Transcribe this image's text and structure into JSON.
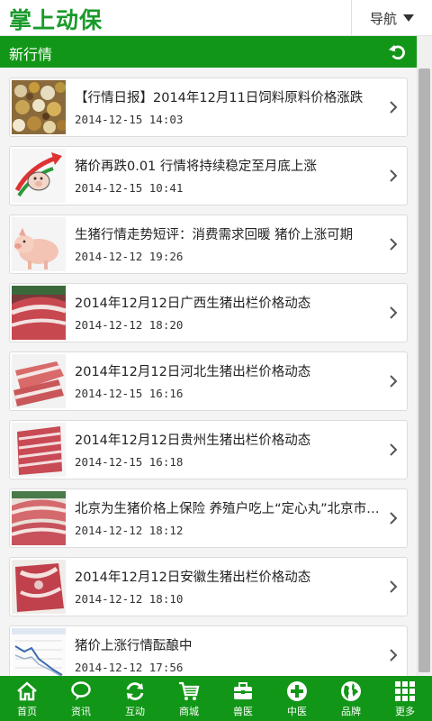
{
  "header": {
    "logo": "掌上动保",
    "nav_label": "导航"
  },
  "section": {
    "title": "新行情"
  },
  "news": [
    {
      "title": "【行情日报】2014年12月11日饲料原料价格涨跌",
      "date": "2014-12-15 14:03",
      "thumb": "grains-icon"
    },
    {
      "title": "猪价再跌0.01 行情将持续稳定至月底上涨",
      "date": "2014-12-15 10:41",
      "thumb": "pig-arrow-icon"
    },
    {
      "title": "生猪行情走势短评：消费需求回暖 猪价上涨可期",
      "date": "2014-12-12 19:26",
      "thumb": "piglet-icon"
    },
    {
      "title": "2014年12月12日广西生猪出栏价格动态",
      "date": "2014-12-12 18:20",
      "thumb": "pork-icon"
    },
    {
      "title": "2014年12月12日河北生猪出栏价格动态",
      "date": "2014-12-15 16:16",
      "thumb": "pork-icon"
    },
    {
      "title": "2014年12月12日贵州生猪出栏价格动态",
      "date": "2014-12-15 16:18",
      "thumb": "pork-icon"
    },
    {
      "title": "北京为生猪价格上保险 养殖户吃上“定心丸”北京市生猪价格指数保险试点",
      "date": "2014-12-12 18:12",
      "thumb": "pork-icon"
    },
    {
      "title": "2014年12月12日安徽生猪出栏价格动态",
      "date": "2014-12-12 18:10",
      "thumb": "pork-icon"
    },
    {
      "title": "猪价上涨行情酝酿中",
      "date": "2014-12-12 17:56",
      "thumb": "price-chart-icon"
    }
  ],
  "tabs": [
    {
      "label": "首页",
      "icon": "home-icon"
    },
    {
      "label": "资讯",
      "icon": "speech-bubble-icon"
    },
    {
      "label": "互动",
      "icon": "refresh-arrows-icon"
    },
    {
      "label": "商城",
      "icon": "cart-icon"
    },
    {
      "label": "兽医",
      "icon": "medical-kit-icon"
    },
    {
      "label": "中医",
      "icon": "plus-circle-icon"
    },
    {
      "label": "品牌",
      "icon": "globe-icon"
    },
    {
      "label": "更多",
      "icon": "grid-icon"
    }
  ],
  "colors": {
    "brand_green": "#129617",
    "logo_green": "#1a9a2a"
  }
}
